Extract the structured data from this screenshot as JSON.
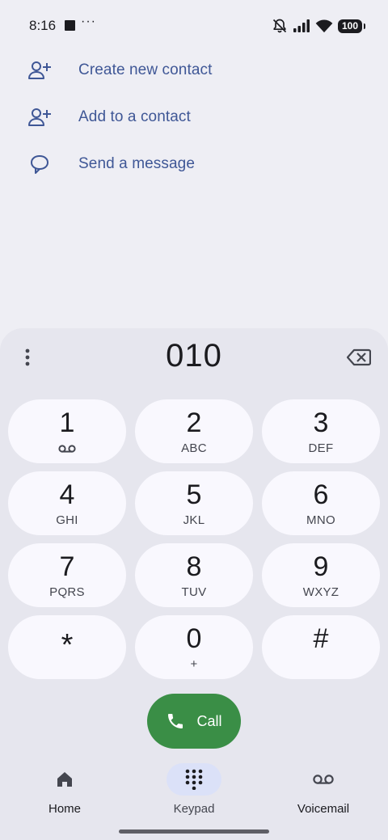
{
  "status_bar": {
    "time": "8:16",
    "dots": "···",
    "battery": "100"
  },
  "suggestions": [
    {
      "label": "Create new contact",
      "icon": "person-add-icon"
    },
    {
      "label": "Add to a contact",
      "icon": "person-add-icon"
    },
    {
      "label": "Send a message",
      "icon": "message-icon"
    }
  ],
  "dialer": {
    "digits": "010",
    "keys": [
      {
        "digit": "1",
        "letters": "",
        "icon": "voicemail-icon"
      },
      {
        "digit": "2",
        "letters": "ABC"
      },
      {
        "digit": "3",
        "letters": "DEF"
      },
      {
        "digit": "4",
        "letters": "GHI"
      },
      {
        "digit": "5",
        "letters": "JKL"
      },
      {
        "digit": "6",
        "letters": "MNO"
      },
      {
        "digit": "7",
        "letters": "PQRS"
      },
      {
        "digit": "8",
        "letters": "TUV"
      },
      {
        "digit": "9",
        "letters": "WXYZ"
      },
      {
        "digit": "*",
        "letters": ""
      },
      {
        "digit": "0",
        "letters": "+"
      },
      {
        "digit": "#",
        "letters": ""
      }
    ],
    "call_label": "Call"
  },
  "nav": {
    "items": [
      {
        "label": "Home",
        "icon": "home-icon"
      },
      {
        "label": "Keypad",
        "icon": "dialpad-icon",
        "active": true
      },
      {
        "label": "Voicemail",
        "icon": "voicemail-icon"
      }
    ]
  },
  "colors": {
    "accent_text": "#3f5796",
    "call_green": "#3a8e46",
    "active_pill": "#dbe1f8",
    "key_bg": "#f9f8fe",
    "sheet_bg": "#e6e6ee",
    "page_bg": "#eeeef4"
  }
}
